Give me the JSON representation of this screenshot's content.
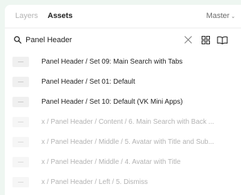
{
  "tabs": {
    "layers": "Layers",
    "assets": "Assets"
  },
  "library": {
    "label": "Master",
    "chevron": "⌄"
  },
  "search": {
    "value": "Panel Header",
    "icons": [
      "search-icon",
      "clear-icon",
      "grid-view-icon",
      "library-book-icon"
    ]
  },
  "results": [
    {
      "label": "Panel Header / Set 09: Main Search with Tabs",
      "state": "active"
    },
    {
      "label": "Panel Header / Set 01: Default",
      "state": "active"
    },
    {
      "label": "Panel Header / Set 10: Default (VK Mini Apps)",
      "state": "active"
    },
    {
      "label": "x / Panel Header / Content / 6. Main Search with Back ...",
      "state": "deprecated"
    },
    {
      "label": "x / Panel Header / Middle / 5. Avatar with Title and Sub...",
      "state": "deprecated"
    },
    {
      "label": "x / Panel Header / Middle / 4. Avatar with Title",
      "state": "deprecated"
    },
    {
      "label": "x / Panel Header / Left / 5. Dismiss",
      "state": "deprecated"
    }
  ],
  "colors": {
    "background": "#eef6f1",
    "panel": "#ffffff",
    "text": "#1e1e1e",
    "muted_text": "#b3b3b3"
  }
}
